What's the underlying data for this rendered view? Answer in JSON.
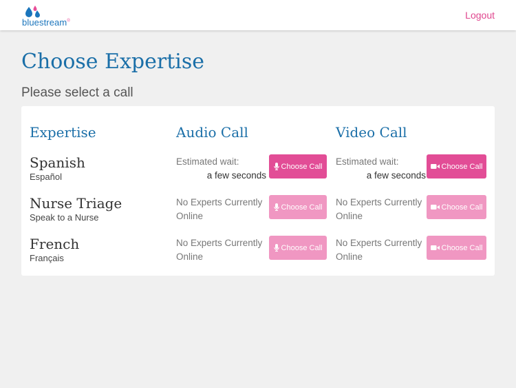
{
  "brand": {
    "name": "bluestream",
    "mark": "®",
    "colors": {
      "blue": "#1b75bc",
      "pink": "#e84d98"
    }
  },
  "header": {
    "logout_label": "Logout"
  },
  "page": {
    "title": "Choose Expertise",
    "subtitle": "Please select a call"
  },
  "table": {
    "columns": [
      "Expertise",
      "Audio Call",
      "Video Call"
    ],
    "rows": [
      {
        "name": "Spanish",
        "subtitle": "Español",
        "audio": {
          "status_line1": "Estimated wait:",
          "status_line2": "a few seconds",
          "available": true,
          "button_label": "Choose Call",
          "icon": "microphone-icon"
        },
        "video": {
          "status_line1": "Estimated wait:",
          "status_line2": "a few seconds",
          "available": true,
          "button_label": "Choose Call",
          "icon": "video-camera-icon"
        }
      },
      {
        "name": "Nurse Triage",
        "subtitle": "Speak to a Nurse",
        "audio": {
          "status_line1": "No Experts Currently",
          "status_line2": "Online",
          "available": false,
          "button_label": "Choose Call",
          "icon": "microphone-icon"
        },
        "video": {
          "status_line1": "No Experts Currently",
          "status_line2": "Online",
          "available": false,
          "button_label": "Choose Call",
          "icon": "video-camera-icon"
        }
      },
      {
        "name": "French",
        "subtitle": "Français",
        "audio": {
          "status_line1": "No Experts Currently",
          "status_line2": "Online",
          "available": false,
          "button_label": "Choose Call",
          "icon": "microphone-icon"
        },
        "video": {
          "status_line1": "No Experts Currently",
          "status_line2": "Online",
          "available": false,
          "button_label": "Choose Call",
          "icon": "video-camera-icon"
        }
      }
    ]
  },
  "colors": {
    "title_blue": "#1b6fa8",
    "button_active": "#e24d96",
    "button_disabled": "#f097c2",
    "background": "#f0f0f0"
  }
}
